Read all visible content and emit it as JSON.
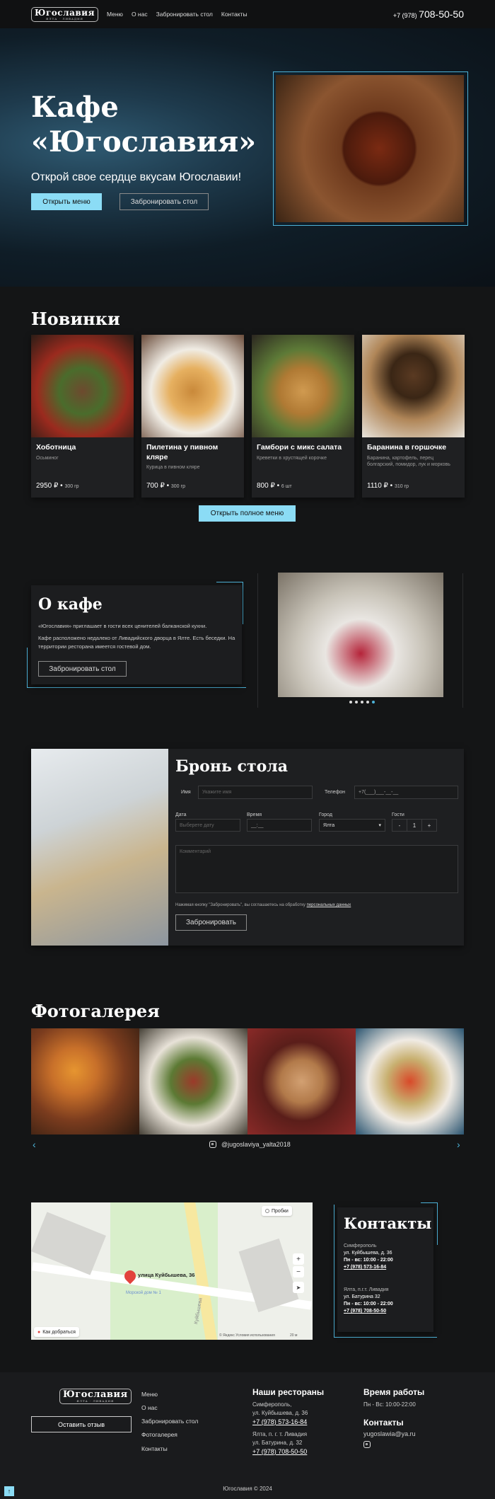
{
  "nav": {
    "logo": "Югославия",
    "logo_sub": "ЯЛТА · ЛИВАДИЯ",
    "links": [
      "Меню",
      "О нас",
      "Забронировать стол",
      "Контакты"
    ],
    "phone_prefix": "+7 (978)",
    "phone_main": "708-50-50"
  },
  "hero": {
    "title_line1": "Кафе",
    "title_line2": "«Югославия»",
    "subtitle": "Открой свое сердце вкусам Югославии!",
    "btn_menu": "Открыть меню",
    "btn_book": "Забронировать стол"
  },
  "news": {
    "title": "Новинки",
    "items": [
      {
        "name": "Хоботница",
        "desc": "Осьминог",
        "price": "2950 ₽",
        "weight": "300 гр"
      },
      {
        "name": "Пилетина у пивном кляре",
        "desc": "Курица в пивном кляре",
        "price": "700 ₽",
        "weight": "300 гр"
      },
      {
        "name": "Гамбори с микс салата",
        "desc": "Креветки в хрустящей корочке",
        "price": "800 ₽",
        "weight": "6 шт"
      },
      {
        "name": "Баранина в горшочке",
        "desc": "Баранина, картофель, перец болгарский, помидор, лук и морковь",
        "price": "1110 ₽",
        "weight": "310 гр"
      }
    ],
    "btn_full": "Открыть полное меню"
  },
  "about": {
    "title": "О кафе",
    "p1": "«Югославия» приглашает в гости всех ценителей балканской кухни.",
    "p2": "Кафе расположено недалеко от Ливадийского дворца в Ялте. Есть беседки. На территории ресторана имеется гостевой дом.",
    "btn": "Забронировать стол"
  },
  "booking": {
    "title": "Бронь стола",
    "name_label": "Имя",
    "name_placeholder": "Укажите имя",
    "phone_label": "Телефон",
    "phone_placeholder": "+7(___)___-__-__",
    "date_label": "Дата",
    "date_placeholder": "Выберете дату",
    "time_label": "Время",
    "time_placeholder": "__:__",
    "city_label": "Город",
    "city_value": "Ялта",
    "guests_label": "Гости",
    "guests_minus": "-",
    "guests_value": "1",
    "guests_plus": "+",
    "comment_placeholder": "Комментарий",
    "consent": "Нажимая кнопку \"Забронировать\", вы соглашаетесь на обработку",
    "consent_link": "персональных данных",
    "btn": "Забронировать"
  },
  "gallery": {
    "title": "Фотогалерея",
    "instagram": "@jugoslaviya_yalta2018",
    "prev": "‹",
    "next": "›"
  },
  "map": {
    "street_label": "улица Куйбышева, 36",
    "poi": "Морской дом № 1",
    "traffic": "Пробки",
    "route": "Как добраться",
    "road": "Куйбышева",
    "copyright": "© Яндекс  Условия использования",
    "scale": "20 м"
  },
  "contacts": {
    "title": "Контакты",
    "city1": "Симферополь",
    "addr1": "ул. Куйбышева, д. 36",
    "hours1": "Пн - вс: 10:00 - 22:00",
    "phone1": "+7 (978) 573-16-84",
    "city2": "Ялта, п.г.т. Ливадия",
    "addr2": "ул. Батурина 32",
    "hours2": "Пн - вс: 10:00 - 22:00",
    "phone2": "+7 (978) 708-50-50"
  },
  "footer": {
    "review_btn": "Оставить отзыв",
    "menu": [
      "Меню",
      "О нас",
      "Забронировать стол",
      "Фотогалерея",
      "Контакты"
    ],
    "rest_title": "Наши рестораны",
    "rest1_city": "Симферополь,",
    "rest1_addr": "ул. Куйбышева, д. 36",
    "rest1_phone": "+7 (978) 573-16-84",
    "rest2_city": "Ялта, п. г. т. Ливадия",
    "rest2_addr": "ул. Батурина, д. 32",
    "rest2_phone": "+7 (978) 708-50-50",
    "hours_title": "Время работы",
    "hours": "Пн - Вс: 10:00-22:00",
    "contacts_title": "Контакты",
    "email": "yugoslawia@ya.ru",
    "copyright": "Югославия © 2024"
  }
}
